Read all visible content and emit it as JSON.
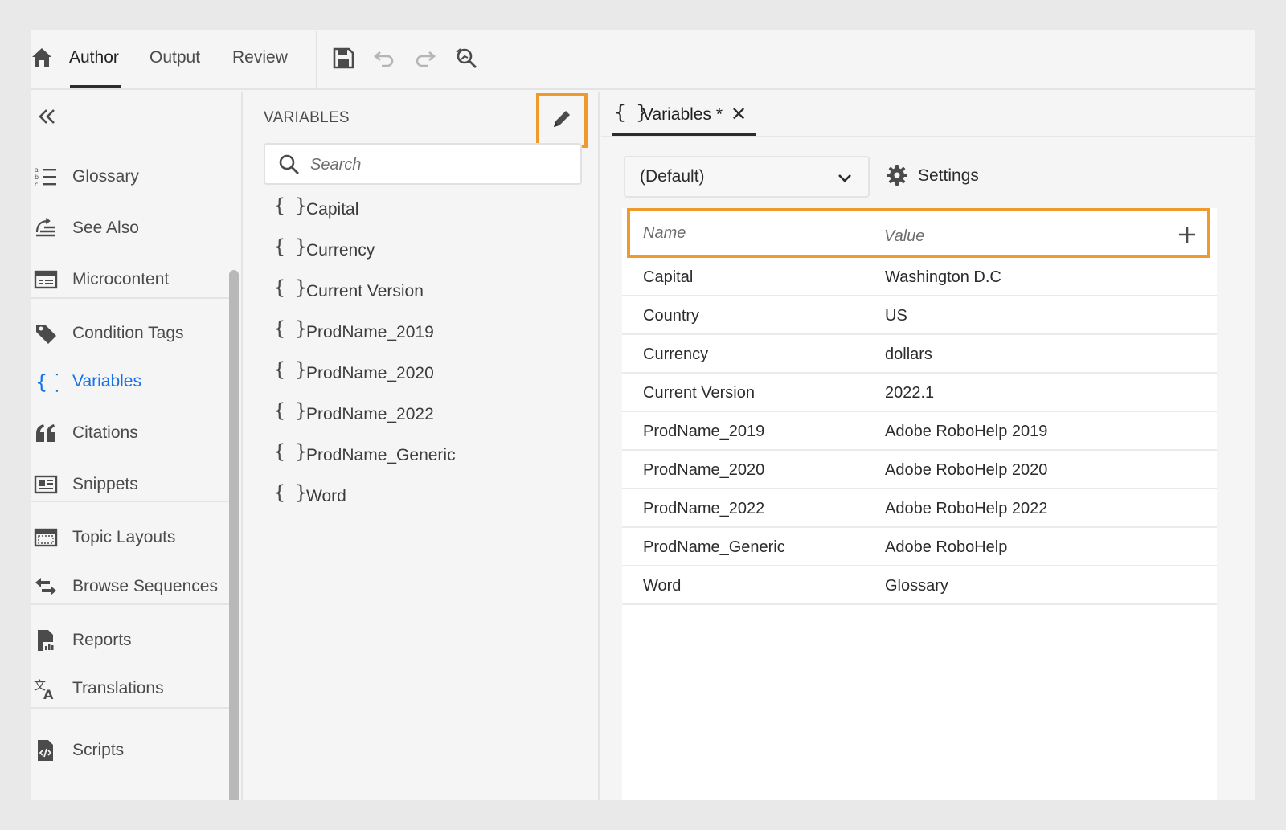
{
  "toolbar": {
    "tabs": [
      {
        "label": "Author"
      },
      {
        "label": "Output"
      },
      {
        "label": "Review"
      }
    ],
    "icons": [
      "home-icon",
      "save-icon",
      "undo-icon",
      "redo-icon",
      "find-replace-icon"
    ]
  },
  "leftnav": {
    "items": [
      {
        "label": "Glossary",
        "icon": "glossary-icon"
      },
      {
        "label": "See Also",
        "icon": "see-also-icon"
      },
      {
        "label": "Microcontent",
        "icon": "microcontent-icon"
      },
      {
        "label": "Condition Tags",
        "icon": "tag-icon"
      },
      {
        "label": "Variables",
        "icon": "braces-icon"
      },
      {
        "label": "Citations",
        "icon": "quote-icon"
      },
      {
        "label": "Snippets",
        "icon": "snippet-icon"
      },
      {
        "label": "Topic Layouts",
        "icon": "layout-icon"
      },
      {
        "label": "Browse Sequences",
        "icon": "sequence-icon"
      },
      {
        "label": "Reports",
        "icon": "reports-icon"
      },
      {
        "label": "Translations",
        "icon": "translate-icon"
      },
      {
        "label": "Scripts",
        "icon": "script-icon"
      }
    ]
  },
  "varpanel": {
    "title": "VARIABLES",
    "search_placeholder": "Search",
    "items": [
      {
        "label": "Capital"
      },
      {
        "label": "Currency"
      },
      {
        "label": "Current Version"
      },
      {
        "label": "ProdName_2019"
      },
      {
        "label": "ProdName_2020"
      },
      {
        "label": "ProdName_2022"
      },
      {
        "label": "ProdName_Generic"
      },
      {
        "label": "Word"
      }
    ]
  },
  "editor": {
    "tab_label": "Variables *",
    "brace": "{ }",
    "close": "✕",
    "dropdown_value": "(Default)",
    "settings_label": "Settings",
    "table": {
      "headers": {
        "name": "Name",
        "value": "Value"
      },
      "rows": [
        {
          "name": "Capital",
          "value": "Washington D.C"
        },
        {
          "name": "Country",
          "value": "US"
        },
        {
          "name": "Currency",
          "value": "dollars"
        },
        {
          "name": "Current Version",
          "value": "2022.1"
        },
        {
          "name": "ProdName_2019",
          "value": "Adobe RoboHelp 2019"
        },
        {
          "name": "ProdName_2020",
          "value": "Adobe RoboHelp 2020"
        },
        {
          "name": "ProdName_2022",
          "value": "Adobe RoboHelp 2022"
        },
        {
          "name": "ProdName_Generic",
          "value": "Adobe RoboHelp"
        },
        {
          "name": "Word",
          "value": "Glossary"
        }
      ]
    }
  },
  "colors": {
    "accent": "#1473e6",
    "highlight": "#ef9a2d"
  }
}
